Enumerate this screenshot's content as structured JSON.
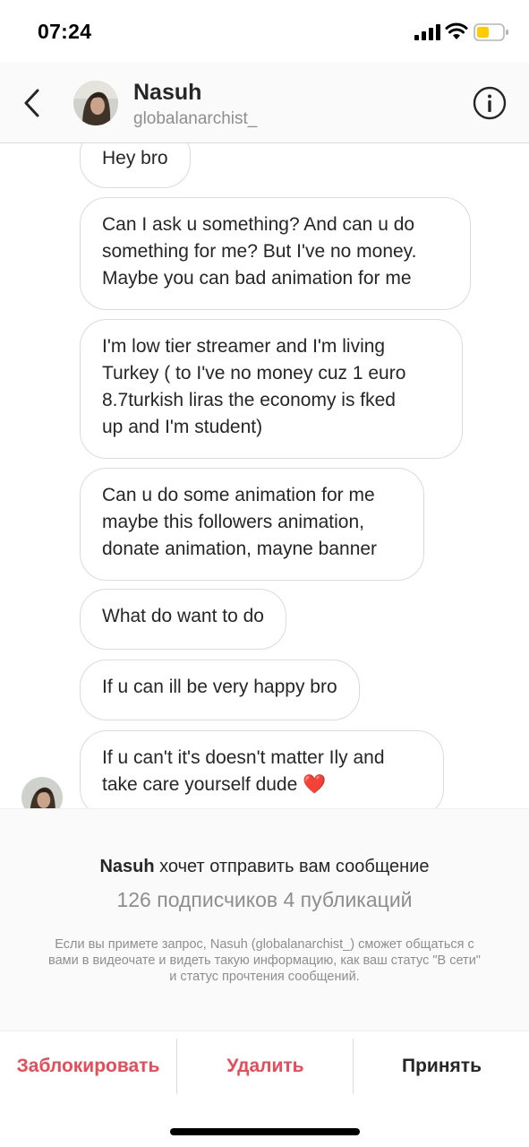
{
  "status_bar": {
    "time": "07:24"
  },
  "header": {
    "name": "Nasuh",
    "username": "globalanarchist_"
  },
  "messages": [
    {
      "text": "Hey bro"
    },
    {
      "text": "Can I ask u something? And can u do\nsomething for me? But I've no money.\nMaybe you can bad animation for me"
    },
    {
      "text": "I'm low tier streamer and I'm living\nTurkey (  to I've no money cuz 1 euro\n8.7turkish liras the economy is fked\nup and I'm student)"
    },
    {
      "text": "Can u do some animation for me\nmaybe this followers animation,\ndonate animation, mayne banner"
    },
    {
      "text": "What do want to do"
    },
    {
      "text": "If u can ill be very happy bro"
    },
    {
      "text": "If u can't it's doesn't matter Ily and\ntake care yourself dude ❤️"
    }
  ],
  "request": {
    "name": "Nasuh",
    "action_text": " хочет отправить вам сообщение",
    "stats": "126 подписчиков 4 публикаций",
    "note": "Если вы примете запрос, Nasuh (globalanarchist_) сможет общаться с вами в видеочате и видеть такую информацию, как ваш статус \"В сети\" и статус прочтения сообщений."
  },
  "actions": {
    "block": "Заблокировать",
    "delete": "Удалить",
    "accept": "Принять"
  },
  "colors": {
    "destructive": "#ed4956",
    "muted": "#8e8e8e",
    "text": "#262626",
    "battery": "#ffcc00"
  },
  "icons": [
    "back-chevron-icon",
    "info-icon",
    "signal-icon",
    "wifi-icon",
    "battery-icon"
  ]
}
